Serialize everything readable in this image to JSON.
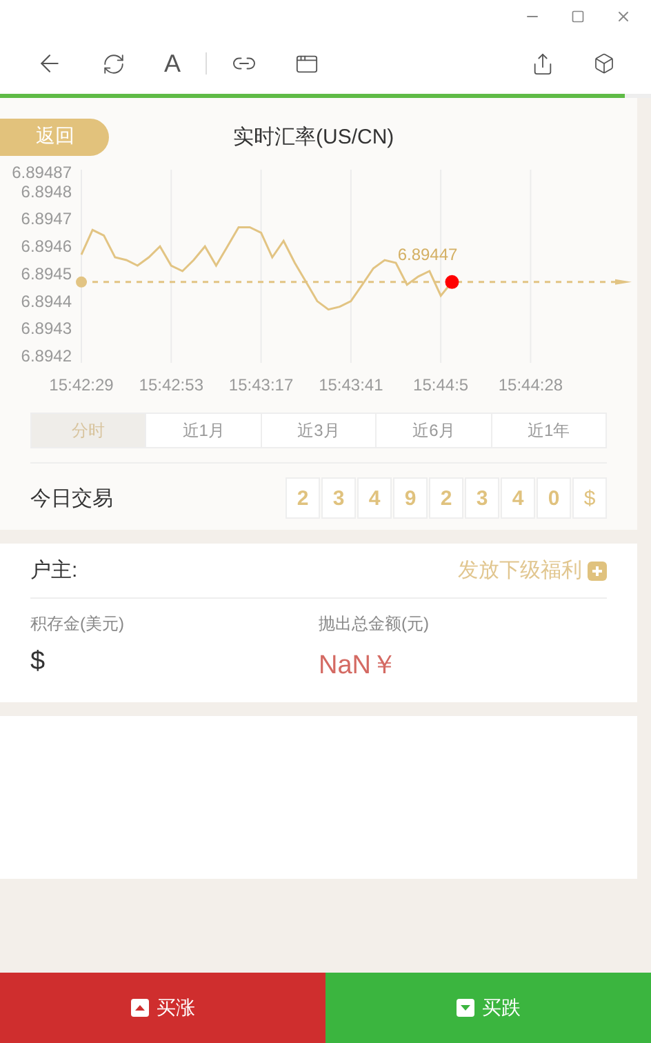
{
  "toolbar": {
    "font_label": "A",
    "progress": {
      "level": 0.96
    }
  },
  "header": {
    "back_button": "返回",
    "title": "实时汇率(US/CN)"
  },
  "chart": {
    "chart_data": {
      "type": "line",
      "categories": [
        "15:42:29",
        null,
        null,
        null,
        null,
        null,
        null,
        null,
        "15:42:53",
        null,
        null,
        null,
        null,
        null,
        null,
        null,
        "15:43:17",
        null,
        null,
        null,
        null,
        null,
        null,
        null,
        "15:43:41",
        null,
        null,
        null,
        null,
        null,
        null,
        null,
        "15:44:5",
        null,
        null,
        null,
        null,
        null,
        null,
        null,
        "15:44:28",
        null,
        null,
        null,
        null,
        null,
        null,
        null,
        null,
        null
      ],
      "series": [
        {
          "color": "#e2c483",
          "values": [
            6.89457,
            6.89466,
            6.89464,
            6.89456,
            6.89455,
            6.89453,
            6.89456,
            6.8946,
            6.89453,
            6.89451,
            6.89455,
            6.8946,
            6.89453,
            6.8946,
            6.89467,
            6.89467,
            6.89465,
            6.89456,
            6.89462,
            6.89454,
            6.89447,
            6.8944,
            6.89437,
            6.89438,
            6.8944,
            6.89446,
            6.89452,
            6.89455,
            6.89454,
            6.89446,
            6.89449,
            6.89451,
            6.89442,
            6.89447,
            null,
            null,
            null,
            null,
            null,
            null,
            null,
            null,
            null,
            null,
            null,
            null,
            null,
            null,
            null,
            null
          ]
        }
      ],
      "ylim": [
        6.8942,
        6.89487
      ],
      "grid": true,
      "ref_lines": [
        {
          "axis": "y",
          "value": 6.89447
        }
      ],
      "yticks": [
        6.8942,
        6.8943,
        6.8944,
        6.8945,
        6.8946,
        6.8947,
        6.8948,
        6.89487
      ],
      "annotations": [
        {
          "y": 6.89447,
          "text": "6.89447"
        }
      ]
    }
  },
  "periods": [
    {
      "label": "分时",
      "selected": true
    },
    {
      "label": "近1月",
      "selected": false
    },
    {
      "label": "近3月",
      "selected": false
    },
    {
      "label": "近6月",
      "selected": false
    },
    {
      "label": "近1年",
      "selected": false
    }
  ],
  "trading": {
    "label": "今日交易",
    "digits": [
      "2",
      "3",
      "4",
      "9",
      "2",
      "3",
      "4",
      "0"
    ],
    "unit": "$"
  },
  "account": {
    "owner_label": "户主:",
    "action": "发放下级福利",
    "fields": [
      {
        "label": "积存金(美元)",
        "value": "$",
        "kind": "neutral"
      },
      {
        "label": "抛出总金额(元)",
        "value": "NaN￥",
        "kind": "alert"
      }
    ]
  },
  "actions": [
    {
      "label": "买涨",
      "kind": "up"
    },
    {
      "label": "买跌",
      "kind": "down"
    }
  ]
}
